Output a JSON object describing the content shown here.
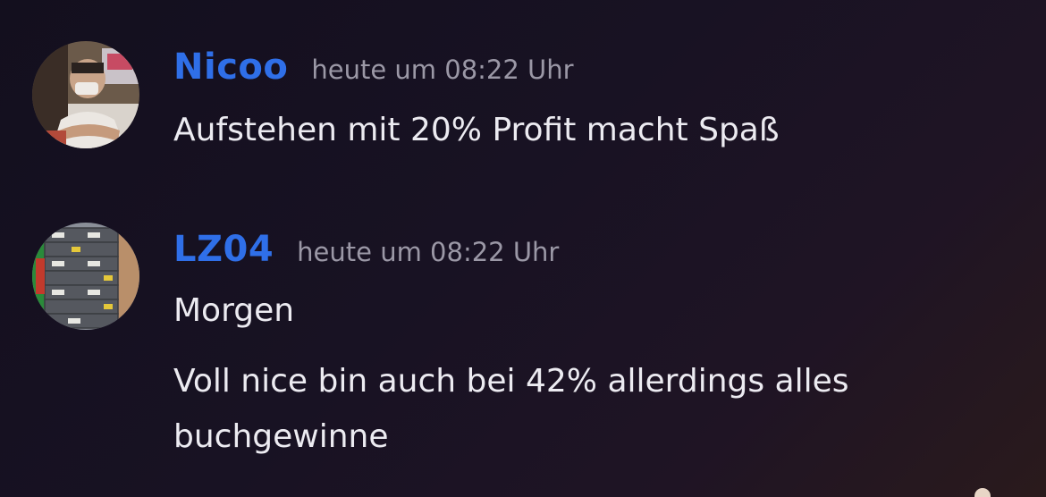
{
  "messages": [
    {
      "author": "Nicoo",
      "timestamp": "heute um 08:22 Uhr",
      "author_color": "#2f6fe8",
      "lines": [
        "Aufstehen mit 20% Profit macht Spaß"
      ]
    },
    {
      "author": "LZ04",
      "timestamp": "heute um 08:22 Uhr",
      "author_color": "#2f6fe8",
      "lines": [
        "Morgen",
        "Voll nice bin auch bei 42% allerdings alles",
        "buchgewinne"
      ]
    }
  ],
  "colors": {
    "background": "#171221",
    "text": "#ecebf1",
    "timestamp": "#9b98a6"
  }
}
